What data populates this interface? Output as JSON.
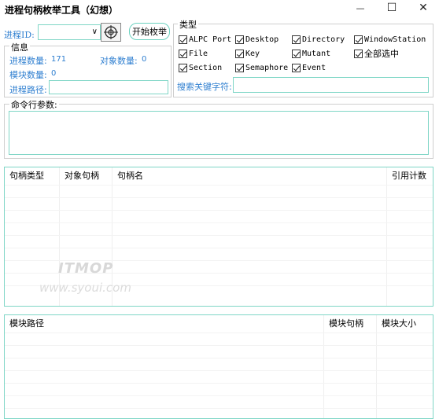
{
  "window": {
    "title": "进程句柄枚举工具（幻想）",
    "minimize_glyph": "—",
    "maximize_glyph": "☐",
    "close_glyph": "✕"
  },
  "process": {
    "label": "进程ID:",
    "value": "",
    "start_button": "开始枚举"
  },
  "info": {
    "title": "信息",
    "process_count_label": "进程数量:",
    "process_count_value": "171",
    "object_count_label": "对象数量:",
    "object_count_value": "0",
    "module_count_label": "模块数量:",
    "module_count_value": "0",
    "process_path_label": "进程路径:",
    "process_path_value": ""
  },
  "types": {
    "title": "类型",
    "items": [
      "ALPC Port",
      "Desktop",
      "Directory",
      "WindowStation",
      "File",
      "Key",
      "Mutant",
      "全部选中",
      "Section",
      "Semaphore",
      "Event"
    ],
    "search_label": "搜索关键字符:",
    "search_value": ""
  },
  "cmdline": {
    "title": "命令行参数:",
    "value": ""
  },
  "handles_table": {
    "columns": [
      "句柄类型",
      "对象句柄",
      "句柄名",
      "引用计数"
    ]
  },
  "modules_table": {
    "columns": [
      "模块路径",
      "模块句柄",
      "模块大小"
    ]
  },
  "watermark": {
    "brand": "ITMOP",
    "url": "www.syoui.com"
  }
}
